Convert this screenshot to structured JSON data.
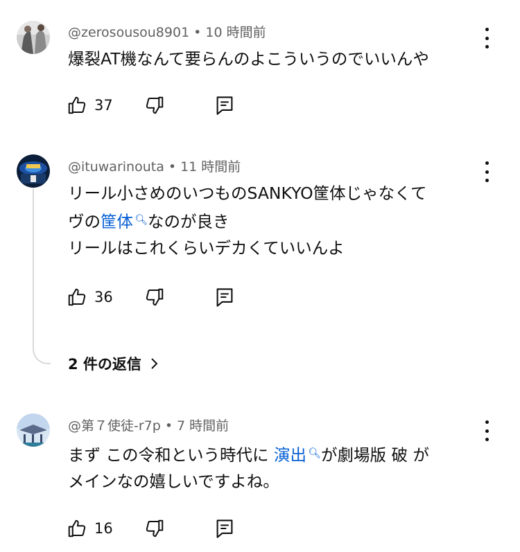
{
  "comments": [
    {
      "author": "@zerosousou8901",
      "time": "10 時間前",
      "lines": [
        "爆裂AT機なんて要らんのよこういうのでいいんや"
      ],
      "likes": "37"
    },
    {
      "author": "@ituwarinouta",
      "time": "11 時間前",
      "line1": "リール小さめのいつものSANKYO筐体じゃなくて",
      "line2_pre": "ヴの",
      "line2_link": "筐体",
      "line2_post": "なのが良き",
      "line3": "リールはこれくらいデカくていいんよ",
      "likes": "36",
      "replies": "2 件の返信"
    },
    {
      "author": "@第７使徒-r7p",
      "time": "7 時間前",
      "line1_pre": "まず この令和という時代に ",
      "line1_link": "演出",
      "line1_post": "が劇場版 破 が",
      "line2": "メインなの嬉しいですよね。",
      "likes": "16"
    }
  ],
  "meta_separator": "•",
  "icons": [
    "like-icon",
    "dislike-icon",
    "reply-icon",
    "more-icon",
    "search-icon",
    "chevron-right-icon"
  ],
  "colors": {
    "text": "#0f0f0f",
    "secondary": "#606060",
    "link": "#065fd4"
  }
}
